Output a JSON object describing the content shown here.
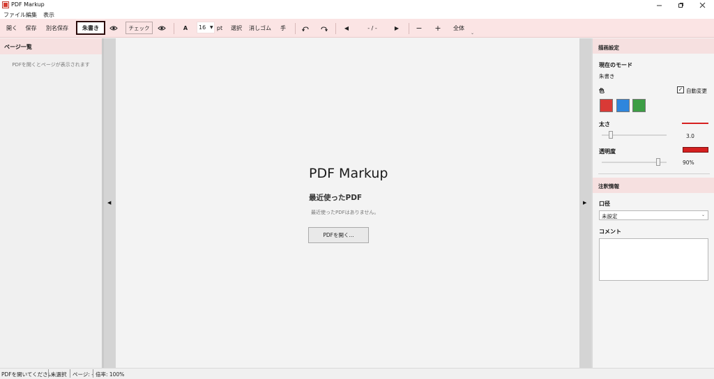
{
  "window": {
    "title": "PDF Markup"
  },
  "menu": [
    "ファイル",
    "編集",
    "表示"
  ],
  "toolbar": {
    "open": "開く",
    "save": "保存",
    "save_as": "別名保存",
    "red_pen": "朱書き",
    "check": "チェック",
    "font": "A",
    "font_size": "16",
    "pt": "pt",
    "select": "選択",
    "eraser": "消しゴム",
    "hand": "手",
    "page_indicator": "- / -",
    "zoom_out": "−",
    "zoom_in": "+",
    "fit": "全体"
  },
  "left_panel": {
    "title": "ページ一覧",
    "empty_message": "PDFを開くとページが表示されます"
  },
  "center": {
    "app_title": "PDF Markup",
    "recent_heading": "最近使ったPDF",
    "recent_empty": "最近使ったPDFはありません。",
    "open_button": "PDFを開く..."
  },
  "right_panel": {
    "drawing_settings": "描画設定",
    "current_mode_label": "現在のモード",
    "current_mode_value": "朱書き",
    "color_label": "色",
    "auto_change_label": "自動変更",
    "auto_change_checked": true,
    "colors": [
      "#d93a36",
      "#2f86dd",
      "#3d9e45"
    ],
    "thickness_label": "太さ",
    "thickness_value": "3.0",
    "thickness_level": 0.12,
    "opacity_label": "透明度",
    "opacity_value": "90%",
    "opacity_level": 0.9,
    "annotation_info": "注釈情報",
    "diameter_label": "口径",
    "diameter_value": "未設定",
    "comment_label": "コメント"
  },
  "status": {
    "message": "PDFを開いてください",
    "selection": "未選択",
    "page": "ページ: -",
    "zoom": "倍率: 100%"
  }
}
